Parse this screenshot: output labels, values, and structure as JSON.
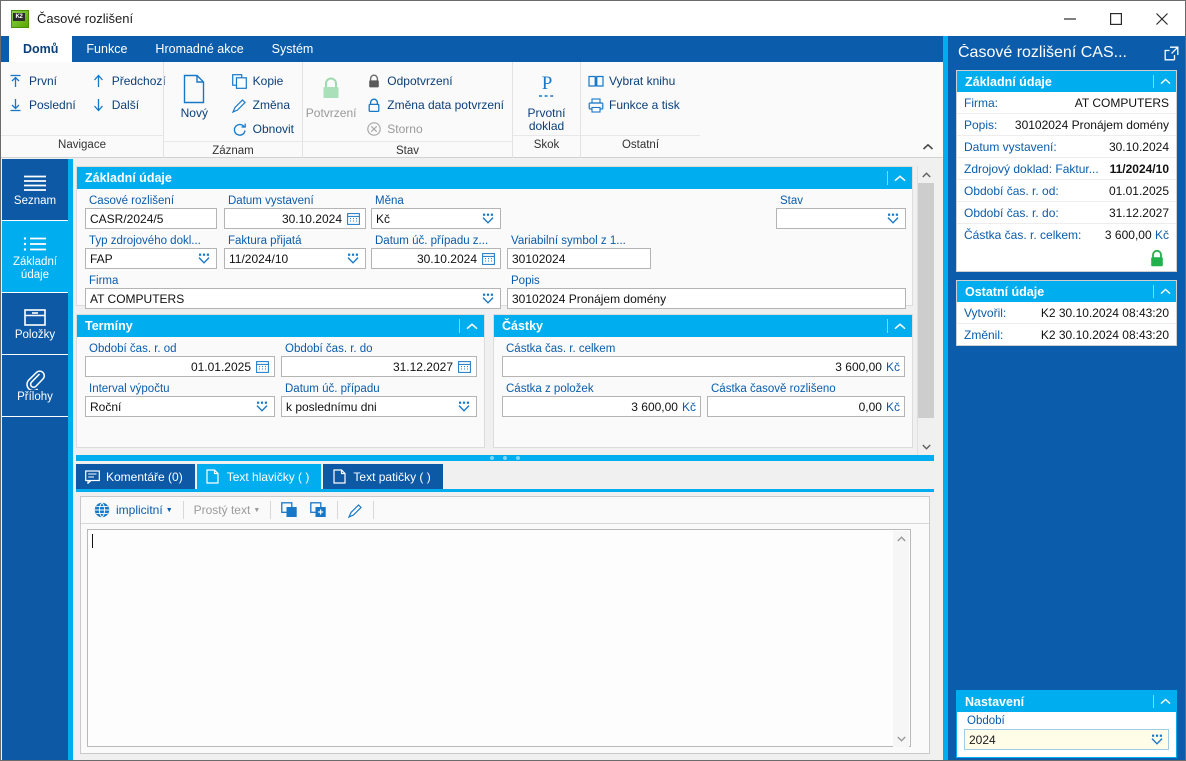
{
  "window": {
    "title": "Časové rozlišení",
    "app_icon": "k2-app-icon",
    "minimize": "minimize-icon",
    "maximize": "maximize-icon",
    "close": "close-icon"
  },
  "ribbon": {
    "tabs": [
      {
        "label": "Domů",
        "active": true
      },
      {
        "label": "Funkce",
        "active": false
      },
      {
        "label": "Hromadné akce",
        "active": false
      },
      {
        "label": "Systém",
        "active": false
      }
    ],
    "groups": [
      {
        "caption": "Navigace",
        "columns": [
          {
            "items": [
              {
                "label": "První",
                "icon": "arrow-up-first-icon",
                "disabled": false
              },
              {
                "label": "Poslední",
                "icon": "arrow-down-last-icon",
                "disabled": false
              }
            ]
          },
          {
            "items": [
              {
                "label": "Předchozí",
                "icon": "arrow-up-icon",
                "disabled": false
              },
              {
                "label": "Další",
                "icon": "arrow-down-icon",
                "disabled": false
              }
            ]
          }
        ]
      },
      {
        "caption": "Záznam",
        "big": {
          "label": "Nový",
          "icon": "new-document-icon",
          "disabled": false
        },
        "columns": [
          {
            "items": [
              {
                "label": "Kopie",
                "icon": "copy-icon",
                "disabled": false
              },
              {
                "label": "Změna",
                "icon": "pencil-icon",
                "disabled": false
              },
              {
                "label": "Obnovit",
                "icon": "refresh-icon",
                "disabled": false
              }
            ]
          }
        ]
      },
      {
        "caption": "Stav",
        "big": {
          "label": "Potvrzení",
          "icon": "lock-green-icon",
          "disabled": true
        },
        "columns": [
          {
            "items": [
              {
                "label": "Odpotvrzení",
                "icon": "lock-gray-icon",
                "disabled": false
              },
              {
                "label": "Změna data potvrzení",
                "icon": "lock-blue-icon",
                "disabled": false
              },
              {
                "label": "Storno",
                "icon": "cancel-circle-icon",
                "disabled": true
              }
            ]
          }
        ]
      },
      {
        "caption": "Skok",
        "big": {
          "label": "Prvotní doklad",
          "icon": "primary-document-icon",
          "disabled": false
        },
        "columns": []
      },
      {
        "caption": "Ostatní",
        "columns": [
          {
            "items": [
              {
                "label": "Vybrat knihu",
                "icon": "book-icon",
                "disabled": false
              },
              {
                "label": "Funkce a tisk",
                "icon": "printer-icon",
                "disabled": false
              }
            ]
          }
        ]
      }
    ],
    "collapse_icon": "chevron-up-icon"
  },
  "sidebar": {
    "items": [
      {
        "label": "Seznam",
        "icon": "list-lines-icon",
        "active": false
      },
      {
        "label": "Základní údaje",
        "icon": "detail-list-icon",
        "active": true
      },
      {
        "label": "Položky",
        "icon": "box-icon",
        "active": false
      },
      {
        "label": "Přílohy",
        "icon": "paperclip-icon",
        "active": false
      }
    ]
  },
  "form": {
    "basic": {
      "title": "Základní údaje",
      "fields": [
        {
          "name": "casove-rozliseni",
          "label": "Časové rozlišení",
          "value": "CASR/2024/5",
          "widget": "text"
        },
        {
          "name": "datum-vystaveni",
          "label": "Datum vystavení",
          "value": "30.10.2024",
          "widget": "date",
          "align": "right"
        },
        {
          "name": "mena",
          "label": "Měna",
          "value": "Kč",
          "widget": "lookup"
        },
        {
          "name": "stav",
          "label": "Stav",
          "value": "",
          "widget": "lookup"
        },
        {
          "name": "typ-zdrojoveho-dokladu",
          "label": "Typ zdrojového dokl...",
          "value": "FAP",
          "widget": "lookup"
        },
        {
          "name": "faktura-prijata",
          "label": "Faktura přijatá",
          "value": "11/2024/10",
          "widget": "lookup"
        },
        {
          "name": "datum-uc-pripadu-z",
          "label": "Datum úč. případu z...",
          "value": "30.10.2024",
          "widget": "date",
          "align": "right"
        },
        {
          "name": "variabilni-symbol-z",
          "label": "Variabilní symbol z 1...",
          "value": "30102024",
          "widget": "text"
        },
        {
          "name": "firma",
          "label": "Firma",
          "value": "AT COMPUTERS",
          "widget": "lookup"
        },
        {
          "name": "popis",
          "label": "Popis",
          "value": "30102024 Pronájem domény",
          "widget": "text"
        }
      ]
    },
    "terms": {
      "title": "Termíny",
      "fields": [
        {
          "name": "obdobi-cas-r-od",
          "label": "Období čas. r. od",
          "value": "01.01.2025",
          "widget": "date",
          "align": "right"
        },
        {
          "name": "obdobi-cas-r-do",
          "label": "Období čas. r. do",
          "value": "31.12.2027",
          "widget": "date",
          "align": "right"
        },
        {
          "name": "interval-vypoctu",
          "label": "Interval výpočtu",
          "value": "Roční",
          "widget": "lookup"
        },
        {
          "name": "datum-uc-pripadu",
          "label": "Datum úč. případu",
          "value": "k poslednímu dni",
          "widget": "lookup"
        }
      ]
    },
    "amounts": {
      "title": "Částky",
      "fields": [
        {
          "name": "castka-cas-r-celkem",
          "label": "Částka čas. r. celkem",
          "value": "3 600,00",
          "currency": "Kč",
          "widget": "money"
        },
        {
          "name": "castka-z-polozek",
          "label": "Částka z položek",
          "value": "3 600,00",
          "currency": "Kč",
          "widget": "money"
        },
        {
          "name": "castka-casove-rozliseno",
          "label": "Částka časově rozlišeno",
          "value": "0,00",
          "currency": "Kč",
          "widget": "money"
        }
      ]
    }
  },
  "bottom_tabs": [
    {
      "label": "Komentáře (0)",
      "icon": "comment-icon",
      "active": false
    },
    {
      "label": "Text hlavičky ( )",
      "icon": "document-icon",
      "active": true
    },
    {
      "label": "Text patičky ( )",
      "icon": "document-icon",
      "active": false
    }
  ],
  "editor": {
    "toolbar": [
      {
        "name": "language-globe",
        "icon": "globe-icon",
        "label": "implicitní",
        "muted": false,
        "caret": true
      },
      {
        "name": "format-select",
        "icon": "",
        "label": "Prostý text",
        "muted": true,
        "caret": true
      },
      {
        "name": "copy-block",
        "icon": "copy-block-icon",
        "label": "",
        "muted": false,
        "caret": false
      },
      {
        "name": "paste-block",
        "icon": "paste-block-icon",
        "label": "",
        "muted": false,
        "caret": false
      },
      {
        "name": "edit-pencil",
        "icon": "pencil-icon",
        "label": "",
        "muted": false,
        "caret": false
      }
    ],
    "content": ""
  },
  "right_panel": {
    "title": "Časové rozlišení CAS...",
    "expand_icon": "external-link-icon",
    "basic": {
      "title": "Základní údaje",
      "rows": [
        {
          "key": "Firma:",
          "value": "AT COMPUTERS",
          "bold": false
        },
        {
          "key": "Popis:",
          "value": "30102024 Pronájem domény",
          "bold": false
        },
        {
          "key": "Datum vystavení:",
          "value": "30.10.2024",
          "bold": false
        },
        {
          "key": "Zdrojový doklad: Faktur...",
          "value": "11/2024/10",
          "bold": true
        },
        {
          "key": "Období čas. r. od:",
          "value": "01.01.2025",
          "bold": false
        },
        {
          "key": "Období čas. r. do:",
          "value": "31.12.2027",
          "bold": false
        },
        {
          "key": "Částka čas. r. celkem:",
          "value": "3 600,00",
          "currency": "Kč",
          "bold": false
        }
      ],
      "lock_icon": "lock-green-icon"
    },
    "other": {
      "title": "Ostatní údaje",
      "rows": [
        {
          "key": "Vytvořil:",
          "value": "K2 30.10.2024 08:43:20"
        },
        {
          "key": "Změnil:",
          "value": "K2 30.10.2024 08:43:20"
        }
      ]
    },
    "settings": {
      "title": "Nastavení",
      "field_label": "Období",
      "field_value": "2024",
      "widget": "lookup"
    }
  },
  "colors": {
    "ribbon_blue": "#0b5cab",
    "accent_cyan": "#00aeef",
    "label_blue": "#0b5cab",
    "panel_bg": "#fafafa",
    "lock_green": "#7fd99a"
  }
}
